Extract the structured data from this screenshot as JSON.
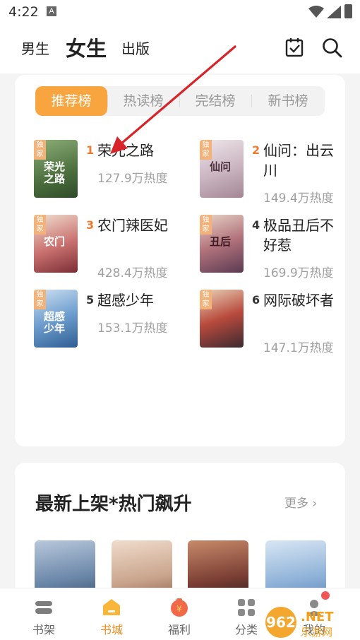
{
  "status": {
    "time": "4:22",
    "a_icon": "A"
  },
  "header": {
    "tabs": [
      "男生",
      "女生",
      "出版"
    ],
    "active_tab": "女生",
    "icons": [
      "calendar-check-icon",
      "search-icon"
    ]
  },
  "ranking": {
    "tabs": [
      "推荐榜",
      "热读榜",
      "完结榜",
      "新书榜"
    ],
    "active_tab": "推荐榜",
    "books": [
      {
        "rank": "1",
        "title": "荣光之路",
        "heat": "127.9万热度",
        "tag": "独家",
        "cover_text": "荣光之路",
        "cover_color": "#5b7e4c"
      },
      {
        "rank": "2",
        "title": "仙问：出云川",
        "heat": "149.4万热度",
        "tag": "独家",
        "cover_text": "仙问",
        "cover_color": "#c9b4c0"
      },
      {
        "rank": "3",
        "title": "农门辣医妃",
        "heat": "428.4万热度",
        "tag": "独家",
        "cover_text": "农门",
        "cover_color": "#b04a4e"
      },
      {
        "rank": "4",
        "title": "极品丑后不好惹",
        "heat": "169.9万热度",
        "tag": "独家",
        "cover_text": "丑后",
        "cover_color": "#8d5a62"
      },
      {
        "rank": "5",
        "title": "超感少年",
        "heat": "153.1万热度",
        "tag": "独家",
        "cover_text": "超感少年",
        "cover_color": "#4a7fb8"
      },
      {
        "rank": "6",
        "title": "网际破坏者",
        "heat": "147.1万热度",
        "tag": "独家",
        "cover_text": "",
        "cover_color": "#a33a3a"
      }
    ]
  },
  "new_section": {
    "title": "最新上架*热门飙升",
    "more": "更多",
    "thumb_colors": [
      "#6a86a8",
      "#c9a48c",
      "#7a3e34",
      "#8fb2d8"
    ]
  },
  "nav": {
    "items": [
      "书架",
      "书城",
      "福利",
      "分类",
      "我的"
    ],
    "active": "书城",
    "accent": "#f08a1c"
  },
  "colors": {
    "accent_orange": "#f8a53f",
    "rank_orange": "#f07a2e",
    "annotation_red": "#d8232a"
  }
}
